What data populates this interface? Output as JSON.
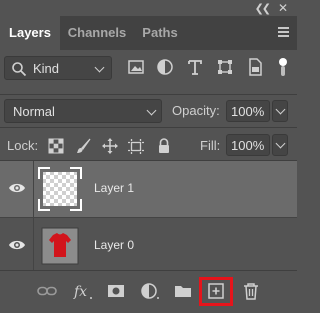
{
  "tabs": [
    {
      "label": "Layers",
      "active": true
    },
    {
      "label": "Channels",
      "active": false
    },
    {
      "label": "Paths",
      "active": false
    }
  ],
  "filter": {
    "kind_label": "Kind",
    "icons": [
      "image-filter-icon",
      "adjustment-filter-icon",
      "type-filter-icon",
      "shape-filter-icon",
      "smart-object-filter-icon"
    ]
  },
  "blend": {
    "mode": "Normal",
    "opacity_label": "Opacity:",
    "opacity_value": "100%"
  },
  "lock": {
    "label": "Lock:",
    "fill_label": "Fill:",
    "fill_value": "100%"
  },
  "layers": [
    {
      "name": "Layer 1",
      "selected": true,
      "visible": true,
      "thumbnail": "transparent"
    },
    {
      "name": "Layer 0",
      "selected": false,
      "visible": true,
      "thumbnail": "red-tshirt"
    }
  ],
  "bottom_icons": [
    "link-layers-icon",
    "fx-icon",
    "mask-icon",
    "adjustment-layer-icon",
    "folder-icon",
    "new-layer-icon",
    "trash-icon"
  ],
  "colors": {
    "panel_bg": "#535353",
    "tabbar_bg": "#424242",
    "selected_layer_bg": "#6b6b6b",
    "highlight": "#e6141b"
  }
}
